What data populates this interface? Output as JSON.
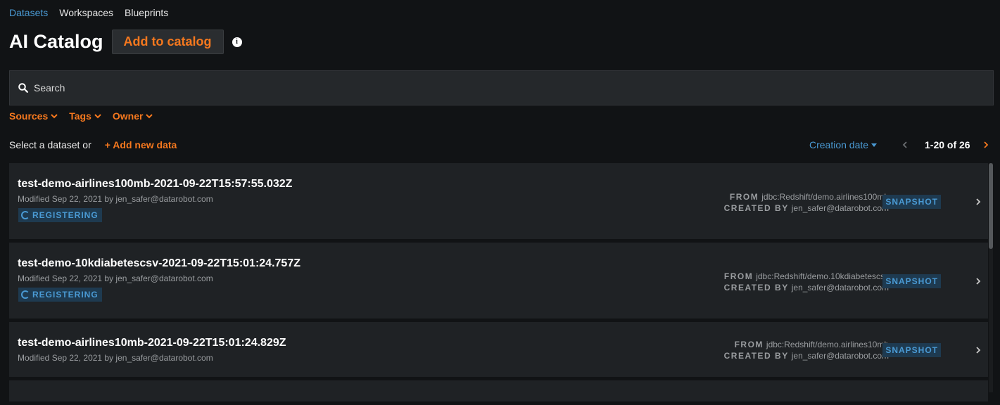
{
  "nav": {
    "items": [
      "Datasets",
      "Workspaces",
      "Blueprints"
    ]
  },
  "header": {
    "title": "AI Catalog",
    "add_button": "Add to catalog"
  },
  "search": {
    "placeholder": "Search"
  },
  "filters": [
    "Sources",
    "Tags",
    "Owner"
  ],
  "select": {
    "text": "Select a dataset or",
    "add_new": "+ Add new data"
  },
  "sort": {
    "label": "Creation date"
  },
  "pagination": {
    "range": "1-20 of 26"
  },
  "meta_labels": {
    "from": "FROM",
    "created_by": "CREATED BY"
  },
  "datasets": [
    {
      "name": "test-demo-airlines100mb-2021-09-22T15:57:55.032Z",
      "modified": "Modified Sep 22, 2021 by jen_safer@datarobot.com",
      "status": "REGISTERING",
      "from": "jdbc:Redshift/demo.airlines100mb",
      "created_by": "jen_safer@datarobot.com",
      "type": "SNAPSHOT"
    },
    {
      "name": "test-demo-10kdiabetescsv-2021-09-22T15:01:24.757Z",
      "modified": "Modified Sep 22, 2021 by jen_safer@datarobot.com",
      "status": "REGISTERING",
      "from": "jdbc:Redshift/demo.10kdiabetescsv",
      "created_by": "jen_safer@datarobot.com",
      "type": "SNAPSHOT"
    },
    {
      "name": "test-demo-airlines10mb-2021-09-22T15:01:24.829Z",
      "modified": "Modified Sep 22, 2021 by jen_safer@datarobot.com",
      "from": "jdbc:Redshift/demo.airlines10mb",
      "created_by": "jen_safer@datarobot.com",
      "type": "SNAPSHOT"
    }
  ],
  "colors": {
    "accent": "#f5781e",
    "link": "#4a9ad4",
    "background": "#111315",
    "card": "#1f2225"
  }
}
